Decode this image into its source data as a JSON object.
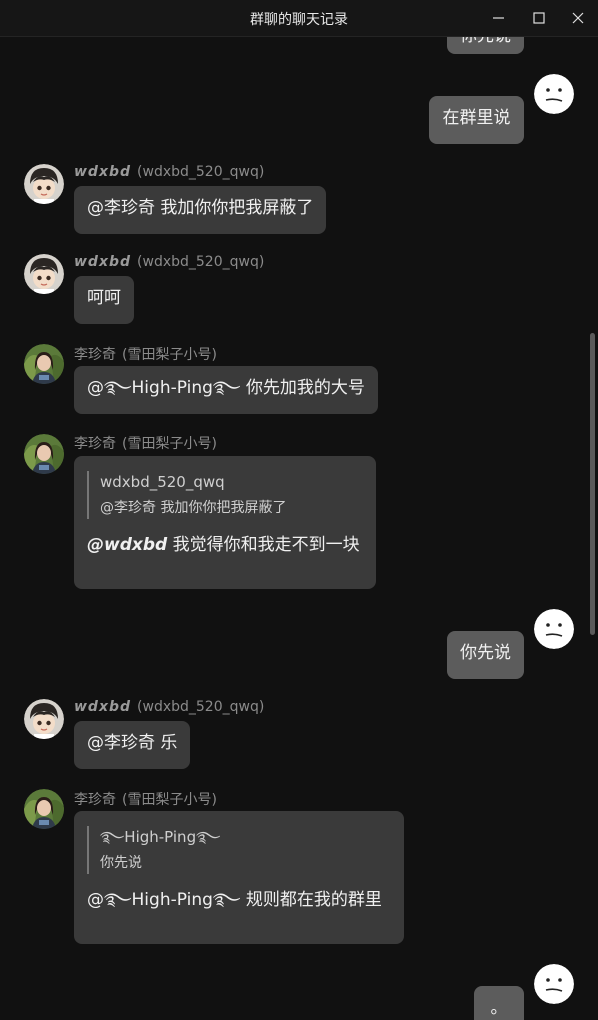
{
  "window": {
    "title": "群聊的聊天记录"
  },
  "messages": [
    {
      "side": "right",
      "text": "你先说"
    },
    {
      "side": "right",
      "text": "在群里说"
    },
    {
      "side": "left",
      "nick": "wdxbd",
      "uid": "(wdxbd_520_qwq)",
      "text": "@李珍奇 我加你你把我屏蔽了"
    },
    {
      "side": "left",
      "nick": "wdxbd",
      "uid": "(wdxbd_520_qwq)",
      "text": "呵呵"
    },
    {
      "side": "left",
      "nick": "李珍奇",
      "uid": "(雪田梨子小号)",
      "text": "@࿐High-Ping࿐ 你先加我的大号"
    },
    {
      "side": "left",
      "nick": "李珍奇",
      "uid": "(雪田梨子小号)",
      "quote_user": "wdxbd_520_qwq",
      "quote_text": "@李珍奇 我加你你把我屏蔽了",
      "mention": "@wdxbd",
      "text": " 我觉得你和我走不到一块"
    },
    {
      "side": "right",
      "text": "你先说"
    },
    {
      "side": "left",
      "nick": "wdxbd",
      "uid": "(wdxbd_520_qwq)",
      "text": "@李珍奇 乐"
    },
    {
      "side": "left",
      "nick": "李珍奇",
      "uid": "(雪田梨子小号)",
      "quote_user": "࿐High-Ping࿐",
      "quote_text": "你先说",
      "text": "@࿐High-Ping࿐ 规则都在我的群里"
    },
    {
      "side": "right",
      "text": "。"
    }
  ],
  "colors": {
    "background": "#111111",
    "bubble_other": "#3a3a3a",
    "bubble_mine": "#5c5c5c",
    "sender_text": "#8b8b8b"
  }
}
